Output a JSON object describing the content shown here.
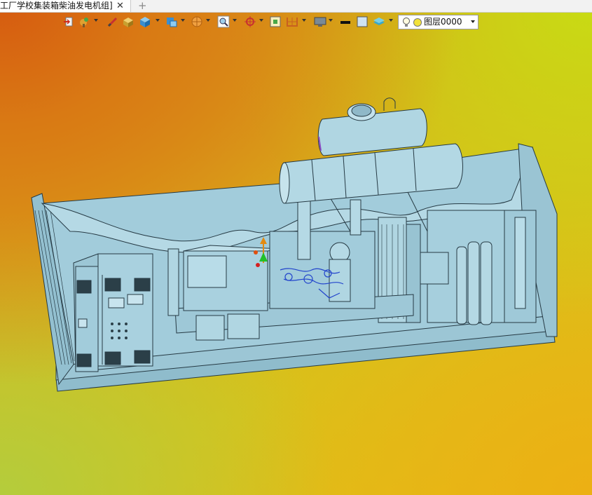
{
  "tab": {
    "title": "工厂学校集装箱柴油发电机组]",
    "close_glyph": "✕",
    "add_glyph": "+"
  },
  "toolbar": {
    "icons": [
      "exit-icon",
      "color-brush-icon",
      "line-style-icon",
      "shaded-box-icon",
      "view-cube-icon",
      "render-mode-icon",
      "section-icon",
      "zoom-window-icon",
      "rotate-pan-icon",
      "frame-icon",
      "split-view-icon",
      "monitor-icon",
      "line-color-swatch",
      "fill-color-swatch",
      "layers-stack-icon"
    ]
  },
  "layer_select": {
    "value": "图层0000"
  },
  "colors": {
    "model_fill": "#a9d1df",
    "model_stroke": "#263a44",
    "accent_blue": "#2244cc"
  }
}
